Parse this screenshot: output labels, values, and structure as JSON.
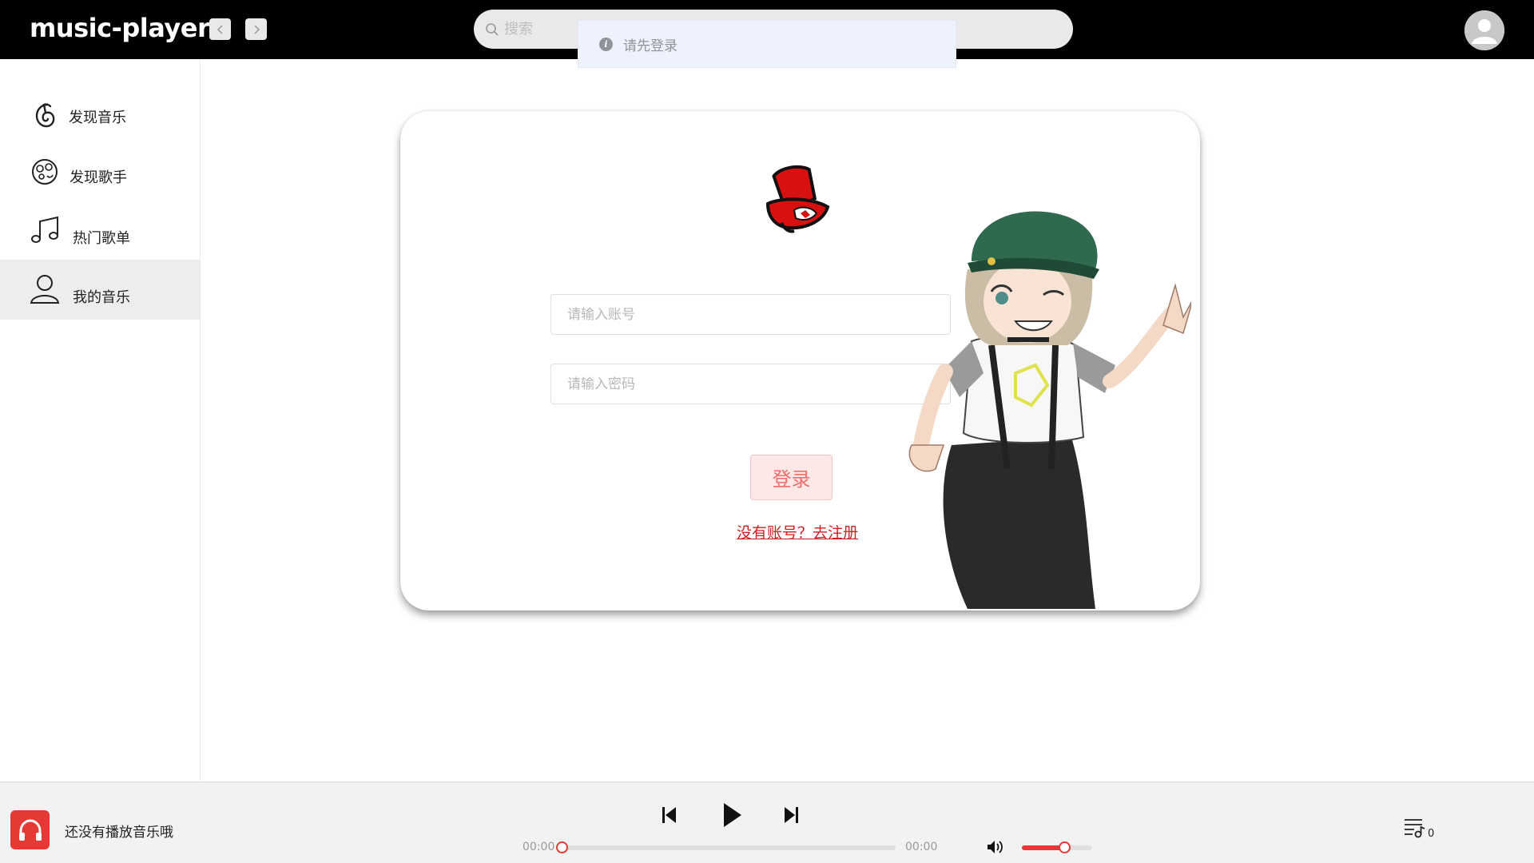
{
  "app": {
    "title": "music-player"
  },
  "header": {
    "back_icon": "chevron-left-icon",
    "forward_icon": "chevron-right-icon",
    "search_placeholder": "搜索",
    "search_icon": "search-icon",
    "avatar_icon": "user-avatar-icon"
  },
  "toast": {
    "icon": "info-icon",
    "message": "请先登录"
  },
  "sidebar": {
    "items": [
      {
        "label": "发现音乐",
        "icon": "netease-music-icon",
        "active": false
      },
      {
        "label": "发现歌手",
        "icon": "vinyl-face-icon",
        "active": false
      },
      {
        "label": "热门歌单",
        "icon": "music-note-icon",
        "active": false
      },
      {
        "label": "我的音乐",
        "icon": "user-icon",
        "active": true
      }
    ],
    "collapse_icon": "chevron-down-circle-icon"
  },
  "login": {
    "logo_icon": "phantom-thieves-hat-logo",
    "username_placeholder": "请输入账号",
    "password_placeholder": "请输入密码",
    "login_label": "登录",
    "register_link": "没有账号？去注册",
    "illustration": "anime-girl-illustration"
  },
  "player": {
    "cover_icon": "headphones-icon",
    "now_playing_text": "还没有播放音乐哦",
    "current_time": "00:00",
    "total_time": "00:00",
    "progress": 0,
    "volume": 0.6,
    "playlist_count": "0",
    "accent_color": "#e53935"
  }
}
